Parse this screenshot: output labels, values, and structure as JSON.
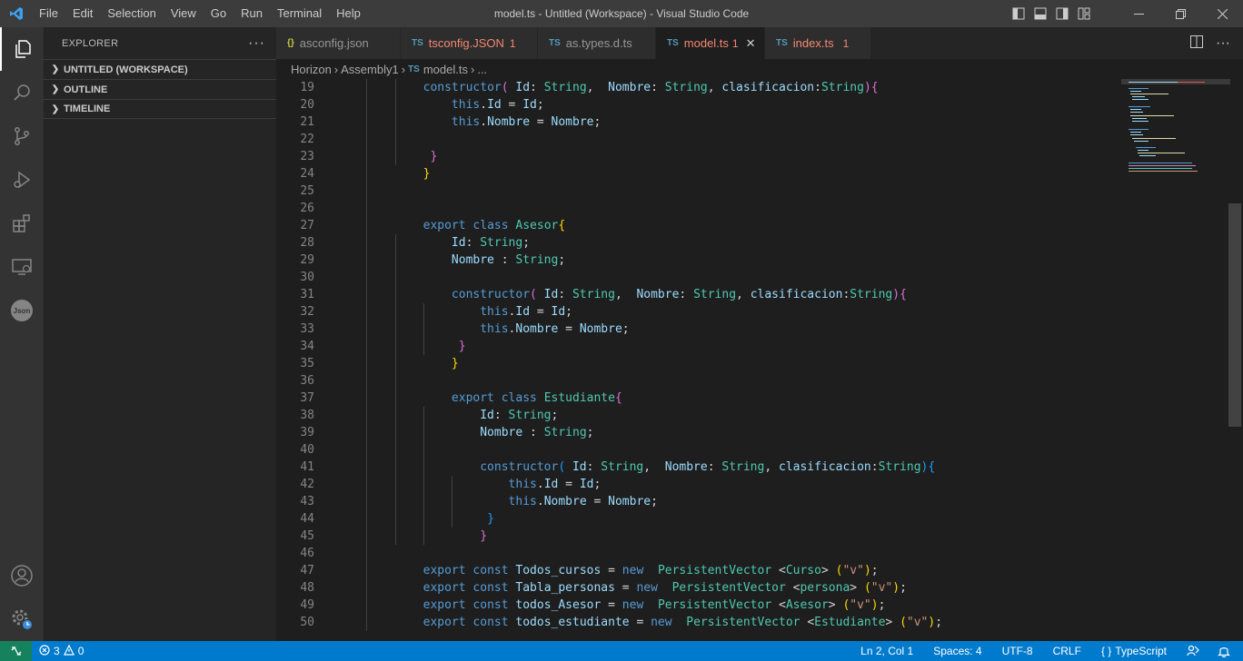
{
  "window": {
    "title": "model.ts - Untitled (Workspace) - Visual Studio Code",
    "menu": [
      "File",
      "Edit",
      "Selection",
      "View",
      "Go",
      "Run",
      "Terminal",
      "Help"
    ]
  },
  "activity_bar": [
    "explorer-icon",
    "search-icon",
    "source-control-icon",
    "run-debug-icon",
    "extensions-icon",
    "remote-explorer-icon",
    "json-icon",
    "accounts-icon",
    "manage-gear-icon"
  ],
  "sidebar": {
    "header": "EXPLORER",
    "sections": [
      "UNTITLED (WORKSPACE)",
      "OUTLINE",
      "TIMELINE"
    ]
  },
  "tabs": [
    {
      "icon": "{}",
      "label": "asconfig.json",
      "badge": ""
    },
    {
      "icon": "TS",
      "label": "tsconfig.JSON",
      "badge": "1"
    },
    {
      "icon": "TS",
      "label": "as.types.d.ts",
      "badge": ""
    },
    {
      "icon": "TS",
      "label": "model.ts",
      "badge": "1"
    },
    {
      "icon": "TS",
      "label": "index.ts",
      "badge": "1"
    }
  ],
  "breadcrumb": [
    "Horizon",
    "Assembly1",
    "model.ts",
    "..."
  ],
  "editor": {
    "line_numbers": [
      "19",
      "20",
      "21",
      "22",
      "23",
      "24",
      "25",
      "26",
      "27",
      "28",
      "29",
      "30",
      "31",
      "32",
      "33",
      "34",
      "35",
      "36",
      "37",
      "38",
      "39",
      "40",
      "41",
      "42",
      "43",
      "44",
      "45",
      "46",
      "47",
      "48",
      "49",
      "50"
    ],
    "lines": [
      "        constructor( Id: String,  Nombre: String, clasificacion:String){",
      "            this.Id = Id;",
      "            this.Nombre = Nombre;",
      "",
      "         }",
      "        }",
      "",
      "",
      "        export class Asesor{",
      "            Id: String;",
      "            Nombre : String;",
      "",
      "            constructor( Id: String,  Nombre: String, clasificacion:String){",
      "                this.Id = Id;",
      "                this.Nombre = Nombre;",
      "             }",
      "            }",
      "",
      "            export class Estudiante{",
      "                Id: String;",
      "                Nombre : String;",
      "",
      "                constructor( Id: String,  Nombre: String, clasificacion:String){",
      "                    this.Id = Id;",
      "                    this.Nombre = Nombre;",
      "                 }",
      "                }",
      "",
      "        export const Todos_cursos = new  PersistentVector <Curso> (\"v\");",
      "        export const Tabla_personas = new  PersistentVector <persona> (\"v\");",
      "        export const todos_Asesor = new  PersistentVector <Asesor> (\"v\");",
      "        export const todos_estudiante = new  PersistentVector <Estudiante> (\"v\");"
    ]
  },
  "status_bar": {
    "errors": "3",
    "warnings": "0",
    "position": "Ln 2, Col 1",
    "spaces": "Spaces: 4",
    "encoding": "UTF-8",
    "eol": "CRLF",
    "language_icon": "{ }",
    "language": "TypeScript"
  },
  "colors": {
    "accent": "#007acc",
    "error": "#f48771",
    "ts_icon": "#519aba"
  }
}
